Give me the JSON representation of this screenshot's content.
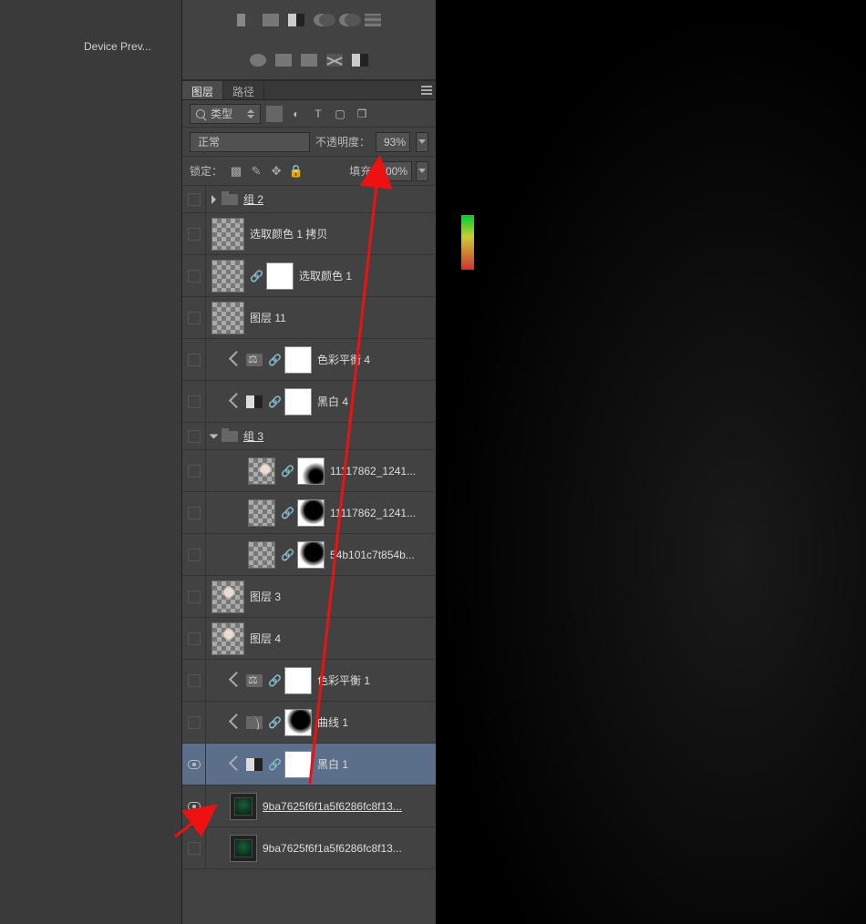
{
  "leftPanel": {
    "devicePreview": "Device Prev..."
  },
  "panel": {
    "tabs": {
      "layers": "图层",
      "paths": "路径"
    },
    "kindFilter": "类型",
    "blend": {
      "mode": "正常",
      "opacityLabel": "不透明度：",
      "opacityValue": "93%"
    },
    "lock": {
      "label": "锁定：",
      "fillLabel": "填充",
      "fillValue": "100%"
    }
  },
  "layers": {
    "group2": "组 2",
    "selColorCopy": "选取颜色 1 拷贝",
    "selColor": "选取颜色 1",
    "layer11": "图层 11",
    "colorBalance4": "色彩平衡 4",
    "bw4": "黑白 4",
    "group3": "组 3",
    "img1": "11117862_1241...",
    "img2": "11117862_1241...",
    "img3": "54b101c7t854b...",
    "layer3": "图层 3",
    "layer4": "图层 4",
    "colorBalance1": "色彩平衡 1",
    "curves1": "曲线 1",
    "bw1": "黑白 1",
    "smart1": "9ba7625f6f1a5f6286fc8f13...",
    "smart2": "9ba7625f6f1a5f6286fc8f13..."
  }
}
